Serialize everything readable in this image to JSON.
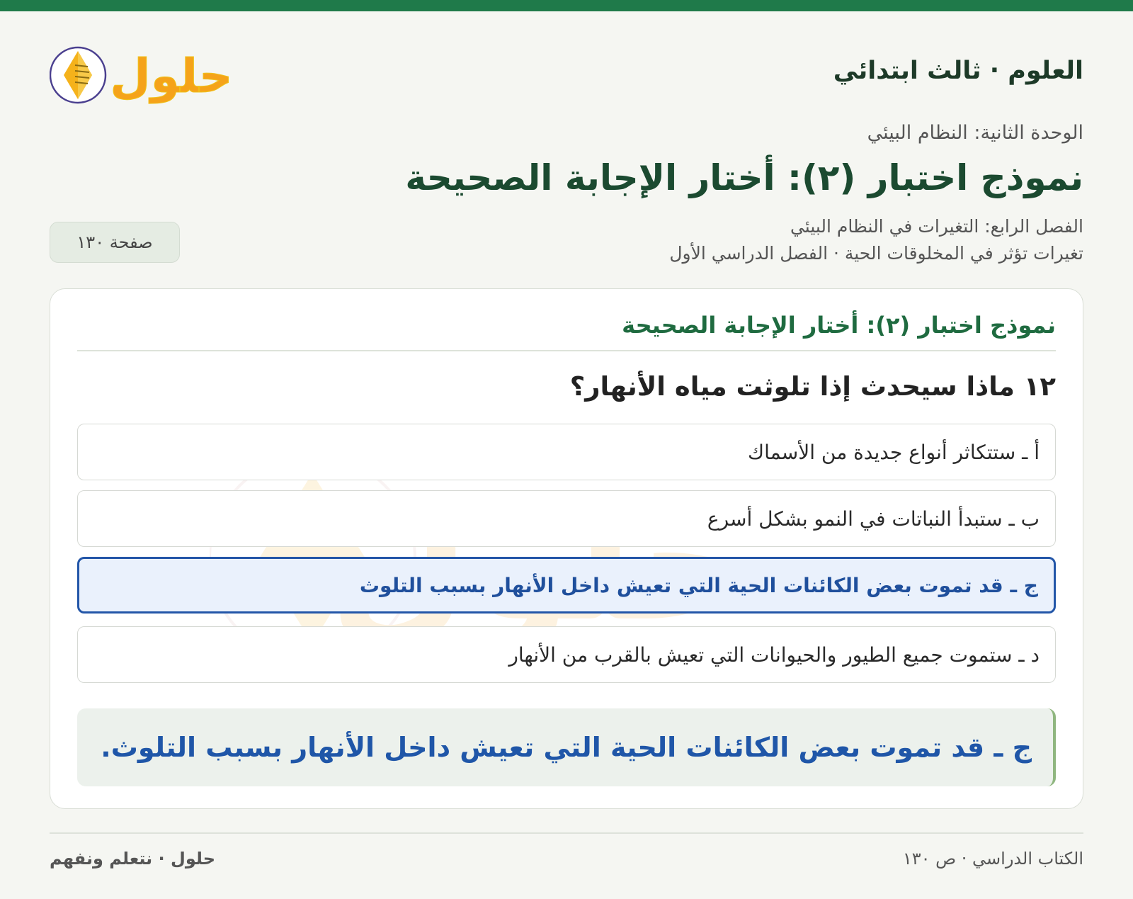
{
  "header": {
    "subject": "العلوم · ثالث ابتدائي",
    "logo_text": "حلول"
  },
  "lesson_info": {
    "unit": "الوحدة الثانية: النظام البيئي",
    "title": "نموذج اختبار (٢): أختار الإجابة الصحيحة",
    "chapter": "الفصل الرابع: التغيرات في النظام البيئي",
    "lesson": "تغيرات تؤثر في المخلوقات الحية · الفصل الدراسي الأول",
    "page_badge": "صفحة ١٣٠"
  },
  "card": {
    "title": "نموذج اختبار (٢): أختار الإجابة الصحيحة",
    "question": "١٢ ماذا سيحدث إذا تلوثت مياه الأنهار؟",
    "options": [
      {
        "label": "أ ـ ستتكاثر أنواع جديدة من الأسماك",
        "selected": false
      },
      {
        "label": "ب ـ ستبدأ النباتات في النمو بشكل أسرع",
        "selected": false
      },
      {
        "label": "ج ـ قد تموت بعض الكائنات الحية التي تعيش داخل الأنهار بسبب التلوث",
        "selected": true
      },
      {
        "label": "د ـ ستموت جميع الطيور والحيوانات التي تعيش بالقرب من الأنهار",
        "selected": false
      }
    ],
    "answer": "ج ـ قد تموت بعض الكائنات الحية التي تعيش داخل الأنهار بسبب التلوث."
  },
  "footer": {
    "right": "الكتاب الدراسي · ص ١٣٠",
    "left": "حلول · نتعلم ونفهم"
  },
  "colors": {
    "accent_green": "#1f7a4a",
    "selected_blue": "#2356a8",
    "logo_orange": "#f5a31a"
  }
}
